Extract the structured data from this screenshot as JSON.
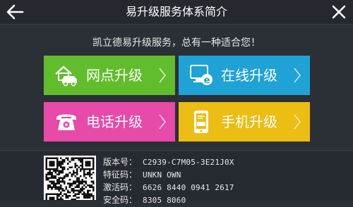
{
  "header": {
    "title": "易升级服务体系简介",
    "back_icon": "back-arrow-icon",
    "close_icon": "close-icon"
  },
  "subtitle": "凯立德易升级服务，总有一种适合您！",
  "tiles": [
    {
      "label": "网点升级",
      "icon": "house-car-icon",
      "color": "#62bd2c"
    },
    {
      "label": "在线升级",
      "icon": "internet-explorer-icon",
      "color": "#1fa2d6"
    },
    {
      "label": "电话升级",
      "icon": "telephone-icon",
      "color": "#e84aa9"
    },
    {
      "label": "手机升级",
      "icon": "mobile-sms-icon",
      "color": "#ecbd12"
    }
  ],
  "info": {
    "version_label": "版本号：",
    "version_value": "C2939-C7M05-3E21J0X",
    "feature_label": "特征码：",
    "feature_value": "UNKN OWN",
    "activation_label": "激活码：",
    "activation_value": "6626 8440 0941 2617",
    "security_label": "安全码：",
    "security_value": "8305 8060"
  }
}
